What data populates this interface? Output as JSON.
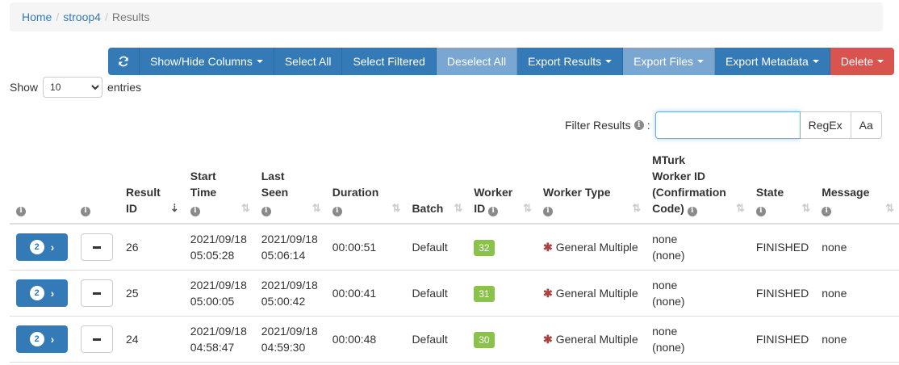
{
  "breadcrumb": {
    "home": "Home",
    "study": "stroop4",
    "current": "Results",
    "separator": "/"
  },
  "toolbar": {
    "refresh_icon": "refresh-icon",
    "show_hide_columns": "Show/Hide Columns",
    "select_all": "Select All",
    "select_filtered": "Select Filtered",
    "deselect_all": "Deselect All",
    "export_results": "Export Results",
    "export_files": "Export Files",
    "export_metadata": "Export Metadata",
    "delete": "Delete"
  },
  "length": {
    "show": "Show",
    "value": "10",
    "entries": "entries"
  },
  "filter": {
    "label": "Filter Results",
    "value": "",
    "regex": "RegEx",
    "case": "Aa"
  },
  "columns": {
    "result_id_1": "Result",
    "result_id_2": "ID",
    "start_time_1": "Start",
    "start_time_2": "Time",
    "last_seen_1": "Last",
    "last_seen_2": "Seen",
    "duration": "Duration",
    "batch": "Batch",
    "worker_id_1": "Worker",
    "worker_id_2": "ID",
    "worker_type": "Worker Type",
    "mturk_1": "MTurk",
    "mturk_2": "Worker ID",
    "mturk_3": "(Confirmation",
    "mturk_4": "Code)",
    "state": "State",
    "message": "Message"
  },
  "rows": [
    {
      "count": "2",
      "result_id": "26",
      "start_date": "2021/09/18",
      "start_time": "05:05:28",
      "last_date": "2021/09/18",
      "last_time": "05:06:14",
      "duration": "00:00:51",
      "batch": "Default",
      "worker_id": "32",
      "worker_type": "General Multiple",
      "mturk_1": "none",
      "mturk_2": "(none)",
      "state": "FINISHED",
      "message": "none"
    },
    {
      "count": "2",
      "result_id": "25",
      "start_date": "2021/09/18",
      "start_time": "05:00:05",
      "last_date": "2021/09/18",
      "last_time": "05:00:42",
      "duration": "00:00:41",
      "batch": "Default",
      "worker_id": "31",
      "worker_type": "General Multiple",
      "mturk_1": "none",
      "mturk_2": "(none)",
      "state": "FINISHED",
      "message": "none"
    },
    {
      "count": "2",
      "result_id": "24",
      "start_date": "2021/09/18",
      "start_time": "04:58:47",
      "last_date": "2021/09/18",
      "last_time": "04:59:30",
      "duration": "00:00:48",
      "batch": "Default",
      "worker_id": "30",
      "worker_type": "General Multiple",
      "mturk_1": "none",
      "mturk_2": "(none)",
      "state": "FINISHED",
      "message": "none"
    }
  ],
  "colors": {
    "primary": "#337ab7",
    "disabled": "#7aa7d2",
    "danger": "#d9534f",
    "worker_badge": "#8bc34a"
  }
}
